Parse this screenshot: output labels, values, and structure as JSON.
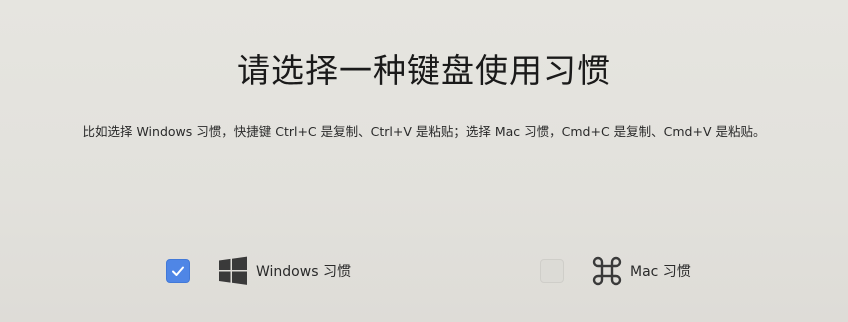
{
  "title": "请选择一种键盘使用习惯",
  "description": "比如选择 Windows 习惯，快捷键 Ctrl+C 是复制、Ctrl+V 是粘贴；选择 Mac 习惯，Cmd+C 是复制、Cmd+V 是粘贴。",
  "options": [
    {
      "label": "Windows 习惯",
      "icon": "windows-logo-icon",
      "checked": true
    },
    {
      "label": "Mac 习惯",
      "icon": "command-key-icon",
      "checked": false
    }
  ],
  "colors": {
    "accent": "#4f86e6",
    "background": "#e4e3de"
  }
}
